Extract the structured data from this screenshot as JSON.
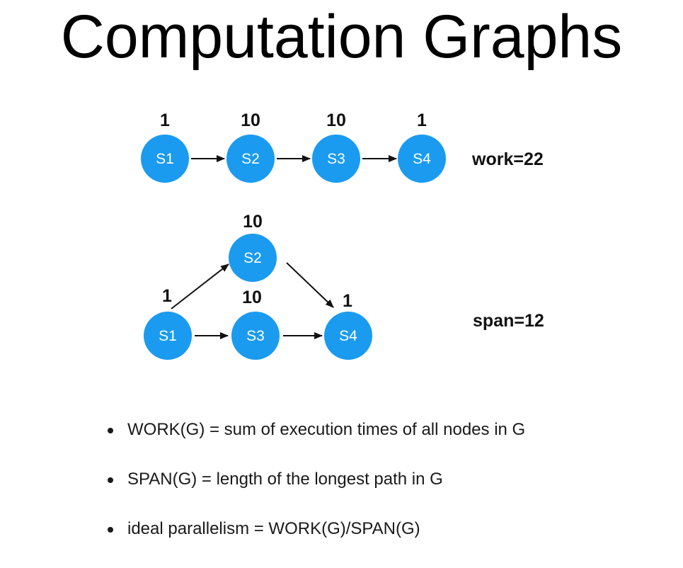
{
  "slide": {
    "title": "Computation Graphs"
  },
  "colors": {
    "node_fill": "#1a9bef",
    "node_text": "#ffffff",
    "edge": "#111111",
    "text": "#111111"
  },
  "graph_chain": {
    "nodes": [
      {
        "id": "S1",
        "label": "S1",
        "weight": "1"
      },
      {
        "id": "S2",
        "label": "S2",
        "weight": "10"
      },
      {
        "id": "S3",
        "label": "S3",
        "weight": "10"
      },
      {
        "id": "S4",
        "label": "S4",
        "weight": "1"
      }
    ],
    "edges": [
      [
        "S1",
        "S2"
      ],
      [
        "S2",
        "S3"
      ],
      [
        "S3",
        "S4"
      ]
    ],
    "metric": "work=22"
  },
  "graph_parallel": {
    "nodes": [
      {
        "id": "S1",
        "label": "S1",
        "weight": "1"
      },
      {
        "id": "S2",
        "label": "S2",
        "weight": "10"
      },
      {
        "id": "S3",
        "label": "S3",
        "weight": "10"
      },
      {
        "id": "S4",
        "label": "S4",
        "weight": "1"
      }
    ],
    "edges": [
      [
        "S1",
        "S2"
      ],
      [
        "S1",
        "S3"
      ],
      [
        "S2",
        "S4"
      ],
      [
        "S3",
        "S4"
      ]
    ],
    "metric": "span=12"
  },
  "bullets": [
    "WORK(G) = sum of execution times of all nodes in G",
    "SPAN(G) = length of the longest path in G",
    "ideal parallelism = WORK(G)/SPAN(G)"
  ]
}
